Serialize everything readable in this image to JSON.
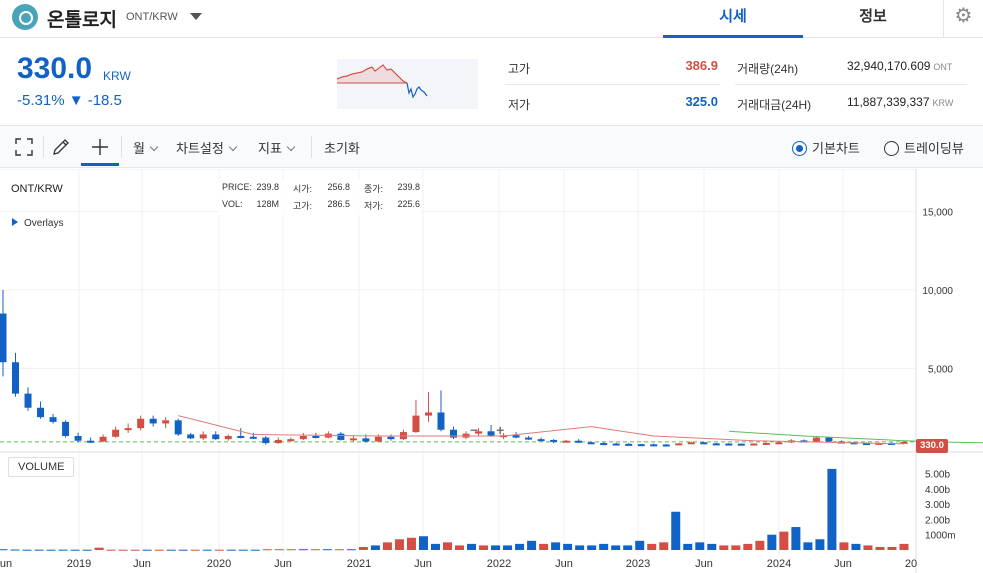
{
  "header": {
    "coin_name": "온톨로지",
    "pair": "ONT/KRW",
    "tabs": [
      "시세",
      "정보"
    ]
  },
  "summary": {
    "price": "330.0",
    "unit": "KRW",
    "change": "-5.31% ▼ -18.5",
    "high_label": "고가",
    "high_value": "386.9",
    "low_label": "저가",
    "low_value": "325.0",
    "volume_label": "거래량(24h)",
    "volume_value": "32,940,170.609",
    "volume_unit": "ONT",
    "amount_label": "거래대금(24H)",
    "amount_value": "11,887,339,337",
    "amount_unit": "KRW"
  },
  "toolbar": {
    "period": "월",
    "chart_settings": "차트설정",
    "indicators": "지표",
    "reset": "초기화",
    "basic_chart": "기본차트",
    "trading_view": "트레이딩뷰"
  },
  "chart_header": {
    "symbol": "ONT/KRW",
    "overlays": "Overlays",
    "ohlc": {
      "price_label": "PRICE:",
      "price": "239.8",
      "vol_label": "VOL:",
      "vol": "128M",
      "open_label": "시가:",
      "open": "256.8",
      "high_label": "고가:",
      "high": "286.5",
      "close_label": "종가:",
      "close": "239.8",
      "low_label": "저가:",
      "low": "225.6"
    },
    "volume_label": "VOLUME",
    "last_price_tag": "330.0",
    "zoom_minus": "−",
    "zoom_plus": "+"
  },
  "colors": {
    "up": "#d24f45",
    "down": "#1261c4",
    "accent": "#1261c4",
    "ma_red": "#e07a7a",
    "ma_green": "#5bbf5b"
  },
  "chart_data": {
    "type": "candlestick",
    "price_axis": {
      "ticks": [
        5000,
        10000,
        15000
      ],
      "tick_labels": [
        "5,000",
        "10,000",
        "15,000"
      ],
      "ylim": [
        0,
        18000
      ]
    },
    "volume_axis": {
      "ticks": [
        1000,
        2000,
        3000,
        4000,
        5000
      ],
      "tick_labels": [
        "1000m",
        "2.00b",
        "3.00b",
        "4.00b",
        "5.00b"
      ]
    },
    "x_labels": [
      "un",
      "2019",
      "Jun",
      "2020",
      "Jun",
      "2021",
      "Jun",
      "2022",
      "Jun",
      "2023",
      "Jun",
      "2024",
      "Jun",
      "20"
    ],
    "candles": [
      {
        "o": 8500,
        "h": 10000,
        "l": 4500,
        "c": 5400
      },
      {
        "o": 5400,
        "h": 6000,
        "l": 3200,
        "c": 3400
      },
      {
        "o": 3400,
        "h": 3800,
        "l": 2300,
        "c": 2500
      },
      {
        "o": 2500,
        "h": 2900,
        "l": 1800,
        "c": 1900
      },
      {
        "o": 1900,
        "h": 2100,
        "l": 1500,
        "c": 1600
      },
      {
        "o": 1600,
        "h": 1700,
        "l": 600,
        "c": 700
      },
      {
        "o": 700,
        "h": 900,
        "l": 300,
        "c": 400
      },
      {
        "o": 400,
        "h": 600,
        "l": 250,
        "c": 350
      },
      {
        "o": 350,
        "h": 800,
        "l": 300,
        "c": 650
      },
      {
        "o": 650,
        "h": 1300,
        "l": 600,
        "c": 1100
      },
      {
        "o": 1100,
        "h": 1500,
        "l": 900,
        "c": 1200
      },
      {
        "o": 1200,
        "h": 2000,
        "l": 1050,
        "c": 1800
      },
      {
        "o": 1800,
        "h": 2000,
        "l": 1300,
        "c": 1500
      },
      {
        "o": 1500,
        "h": 1900,
        "l": 1200,
        "c": 1700
      },
      {
        "o": 1700,
        "h": 1800,
        "l": 700,
        "c": 800
      },
      {
        "o": 800,
        "h": 900,
        "l": 500,
        "c": 550
      },
      {
        "o": 550,
        "h": 1000,
        "l": 450,
        "c": 800
      },
      {
        "o": 800,
        "h": 1000,
        "l": 450,
        "c": 500
      },
      {
        "o": 500,
        "h": 800,
        "l": 400,
        "c": 700
      },
      {
        "o": 700,
        "h": 1200,
        "l": 550,
        "c": 650
      },
      {
        "o": 650,
        "h": 900,
        "l": 500,
        "c": 600
      },
      {
        "o": 600,
        "h": 700,
        "l": 150,
        "c": 250
      },
      {
        "o": 250,
        "h": 600,
        "l": 200,
        "c": 450
      },
      {
        "o": 450,
        "h": 600,
        "l": 350,
        "c": 500
      },
      {
        "o": 500,
        "h": 900,
        "l": 450,
        "c": 700
      },
      {
        "o": 700,
        "h": 900,
        "l": 550,
        "c": 600
      },
      {
        "o": 600,
        "h": 1000,
        "l": 550,
        "c": 850
      },
      {
        "o": 850,
        "h": 950,
        "l": 400,
        "c": 450
      },
      {
        "o": 450,
        "h": 700,
        "l": 350,
        "c": 550
      },
      {
        "o": 550,
        "h": 800,
        "l": 300,
        "c": 350
      },
      {
        "o": 350,
        "h": 800,
        "l": 300,
        "c": 650
      },
      {
        "o": 650,
        "h": 800,
        "l": 400,
        "c": 500
      },
      {
        "o": 500,
        "h": 1100,
        "l": 450,
        "c": 950
      },
      {
        "o": 950,
        "h": 3000,
        "l": 900,
        "c": 2000
      },
      {
        "o": 2000,
        "h": 3500,
        "l": 1600,
        "c": 2200
      },
      {
        "o": 2200,
        "h": 3600,
        "l": 1000,
        "c": 1100
      },
      {
        "o": 1100,
        "h": 1300,
        "l": 500,
        "c": 600
      },
      {
        "o": 600,
        "h": 1000,
        "l": 500,
        "c": 850
      },
      {
        "o": 850,
        "h": 1200,
        "l": 700,
        "c": 1000
      },
      {
        "o": 1000,
        "h": 1400,
        "l": 650,
        "c": 700
      },
      {
        "o": 700,
        "h": 900,
        "l": 500,
        "c": 750
      },
      {
        "o": 750,
        "h": 950,
        "l": 550,
        "c": 600
      },
      {
        "o": 600,
        "h": 700,
        "l": 450,
        "c": 500
      },
      {
        "o": 500,
        "h": 600,
        "l": 400,
        "c": 450
      },
      {
        "o": 450,
        "h": 500,
        "l": 250,
        "c": 350
      },
      {
        "o": 350,
        "h": 450,
        "l": 300,
        "c": 400
      },
      {
        "o": 400,
        "h": 500,
        "l": 250,
        "c": 300
      },
      {
        "o": 300,
        "h": 350,
        "l": 200,
        "c": 250
      },
      {
        "o": 250,
        "h": 300,
        "l": 180,
        "c": 220
      },
      {
        "o": 220,
        "h": 260,
        "l": 170,
        "c": 200
      },
      {
        "o": 200,
        "h": 250,
        "l": 150,
        "c": 180
      },
      {
        "o": 180,
        "h": 200,
        "l": 150,
        "c": 170
      },
      {
        "o": 170,
        "h": 220,
        "l": 150,
        "c": 160
      },
      {
        "o": 160,
        "h": 190,
        "l": 140,
        "c": 150
      },
      {
        "o": 150,
        "h": 260,
        "l": 140,
        "c": 230
      },
      {
        "o": 230,
        "h": 350,
        "l": 200,
        "c": 300
      },
      {
        "o": 300,
        "h": 320,
        "l": 200,
        "c": 230
      },
      {
        "o": 230,
        "h": 260,
        "l": 200,
        "c": 220
      },
      {
        "o": 220,
        "h": 250,
        "l": 190,
        "c": 210
      },
      {
        "o": 210,
        "h": 230,
        "l": 180,
        "c": 190
      },
      {
        "o": 190,
        "h": 230,
        "l": 170,
        "c": 220
      },
      {
        "o": 220,
        "h": 280,
        "l": 200,
        "c": 260
      },
      {
        "o": 260,
        "h": 340,
        "l": 240,
        "c": 300
      },
      {
        "o": 300,
        "h": 500,
        "l": 250,
        "c": 420
      },
      {
        "o": 420,
        "h": 480,
        "l": 300,
        "c": 350
      },
      {
        "o": 350,
        "h": 700,
        "l": 300,
        "c": 600
      },
      {
        "o": 600,
        "h": 650,
        "l": 300,
        "c": 350
      },
      {
        "o": 350,
        "h": 420,
        "l": 280,
        "c": 300
      },
      {
        "o": 300,
        "h": 330,
        "l": 220,
        "c": 250
      },
      {
        "o": 250,
        "h": 290,
        "l": 220,
        "c": 240
      },
      {
        "o": 240,
        "h": 290,
        "l": 220,
        "c": 260
      },
      {
        "o": 260,
        "h": 280,
        "l": 200,
        "c": 230
      },
      {
        "o": 230,
        "h": 390,
        "l": 220,
        "c": 330
      }
    ],
    "volume": [
      50,
      30,
      20,
      20,
      20,
      20,
      20,
      20,
      150,
      20,
      20,
      20,
      20,
      20,
      20,
      20,
      20,
      20,
      20,
      20,
      20,
      20,
      50,
      50,
      50,
      50,
      50,
      50,
      50,
      50,
      200,
      300,
      500,
      700,
      800,
      900,
      400,
      500,
      300,
      400,
      300,
      300,
      300,
      400,
      600,
      400,
      500,
      400,
      300,
      300,
      400,
      300,
      300,
      600,
      400,
      500,
      2500,
      400,
      500,
      400,
      300,
      300,
      400,
      600,
      1000,
      1200,
      1500,
      500,
      700,
      5300,
      500,
      400,
      300,
      200,
      200,
      400
    ],
    "ma_red": [
      [
        14,
        2000
      ],
      [
        20,
        800
      ],
      [
        30,
        700
      ],
      [
        40,
        700
      ],
      [
        47,
        1300
      ],
      [
        52,
        700
      ],
      [
        60,
        400
      ],
      [
        72,
        200
      ]
    ],
    "ma_green": [
      [
        58,
        1000
      ],
      [
        64,
        700
      ],
      [
        72,
        400
      ],
      [
        76,
        300
      ],
      [
        80,
        250
      ],
      [
        87,
        100
      ]
    ]
  }
}
